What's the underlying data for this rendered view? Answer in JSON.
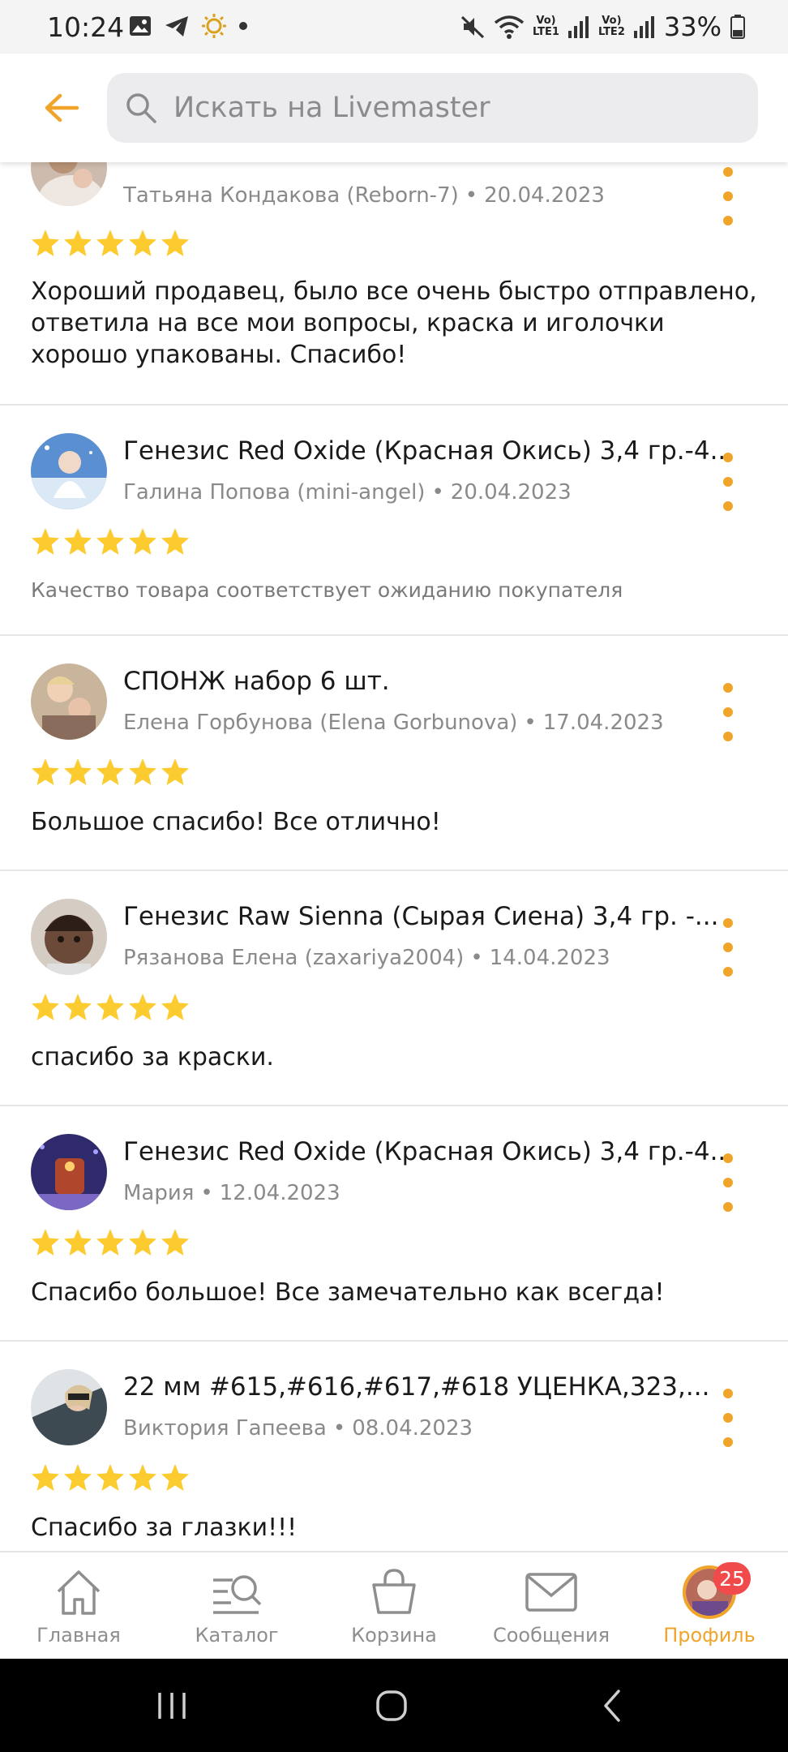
{
  "status_bar": {
    "time": "10:24",
    "battery": "33%",
    "sim1_top": "Vo)",
    "sim1_bottom": "LTE1",
    "sim2_top": "Vo)",
    "sim2_bottom": "LTE2"
  },
  "header": {
    "search_placeholder": "Искать на Livemaster"
  },
  "colors": {
    "accent": "#f0a52a",
    "star": "#fccb2f",
    "badge": "#f04a4a"
  },
  "reviews": [
    {
      "title": "",
      "author": "Татьяна Кондакова (Reborn-7)",
      "date": "20.04.2023",
      "rating": 5,
      "text": "Хороший продавец, было все очень быстро отправлено, ответила на все мои вопросы, краска и иголочки хорошо упакованы. Спасибо!"
    },
    {
      "title": "Генезис Red Oxide (Красная Окись) 3,4 гр.-4...",
      "author": "Галина Попова (mini-angel)",
      "date": "20.04.2023",
      "rating": 5,
      "text": "Качество товара соответствует ожиданию покупателя"
    },
    {
      "title": "СПОНЖ набор 6 шт.",
      "author": "Елена Горбунова (Elena Gorbunova)",
      "date": "17.04.2023",
      "rating": 5,
      "text": "Большое спасибо! Все отлично!"
    },
    {
      "title": "Генезис Raw Sienna (Сырая Сиена) 3,4 гр. -...",
      "author": "Рязанова Елена (zaxariya2004)",
      "date": "14.04.2023",
      "rating": 5,
      "text": "спасибо за краски."
    },
    {
      "title": "Генезис Red Oxide (Красная Окись) 3,4 гр.-4...",
      "author": "Мария",
      "date": "12.04.2023",
      "rating": 5,
      "text": "Спасибо большое! Все замечательно как всегда!"
    },
    {
      "title": "22 мм #615,#616,#617,#618 УЦЕНКА,323,...",
      "author": "Виктория Гапеева",
      "date": "08.04.2023",
      "rating": 5,
      "text": "Спасибо за глазки!!!"
    }
  ],
  "bottom_nav": {
    "home": "Главная",
    "catalog": "Каталог",
    "cart": "Корзина",
    "messages": "Сообщения",
    "profile": "Профиль",
    "profile_badge": "25"
  }
}
